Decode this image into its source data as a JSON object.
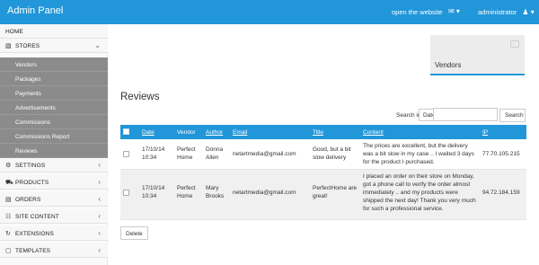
{
  "topbar": {
    "brand": "Admin Panel",
    "open_site": "open the website",
    "mail_icon": "envelope-icon",
    "admin_label": "administrator",
    "user_icon": "user-icon"
  },
  "sidebar": {
    "home": "HOME",
    "stores": "STORES",
    "sub_items": [
      "Vendors",
      "Packages",
      "Payments",
      "Advertisements",
      "Commissions",
      "Commissions Report",
      "Reviews"
    ],
    "sections": [
      "SETTINGS",
      "PRODUCTS",
      "ORDERS",
      "SITE CONTENT",
      "EXTENSIONS",
      "TEMPLATES"
    ]
  },
  "vendors_panel": {
    "title": "Vendors"
  },
  "page": {
    "title": "Reviews"
  },
  "search": {
    "label": "Search in",
    "field_value": "Date",
    "input_value": "",
    "button": "Search"
  },
  "table": {
    "headers": [
      "Date",
      "Vendor",
      "Author",
      "Email",
      "Title",
      "Content",
      "IP"
    ],
    "rows": [
      {
        "date_l1": "17/10/14",
        "date_l2": "10:34",
        "vendor_l1": "Perfect",
        "vendor_l2": "Home",
        "author_l1": "Donna",
        "author_l2": "Allen",
        "email": "netartmedia@gmail.com",
        "title_l1": "Good, but a bit",
        "title_l2": "slow delivery",
        "content_l1": "The prices are excellent, but the delivery",
        "content_l2": "was a bit slow in my case .. I waited 3 days",
        "content_l3": "for the product I purchased.",
        "ip": "77.70.105.215"
      },
      {
        "date_l1": "17/10/14",
        "date_l2": "10:34",
        "vendor_l1": "Perfect",
        "vendor_l2": "Home",
        "author_l1": "Mary",
        "author_l2": "Brooks",
        "email": "netartmedia@gmail.com",
        "title_l1": "PerfectHome are",
        "title_l2": "great!",
        "content_l1": "I placed an order on their store on Monday,",
        "content_l2": "got a phone call to verify the order almost",
        "content_l3": "immediately .. and my products were",
        "content_l4": "shipped the next day! Thank you very much",
        "content_l5": "for such a professional service.",
        "ip": "94.72.184.159"
      }
    ]
  },
  "actions": {
    "delete": "Delete"
  },
  "colors": {
    "accent": "#2196d9",
    "submenu": "#8b8b8b"
  }
}
